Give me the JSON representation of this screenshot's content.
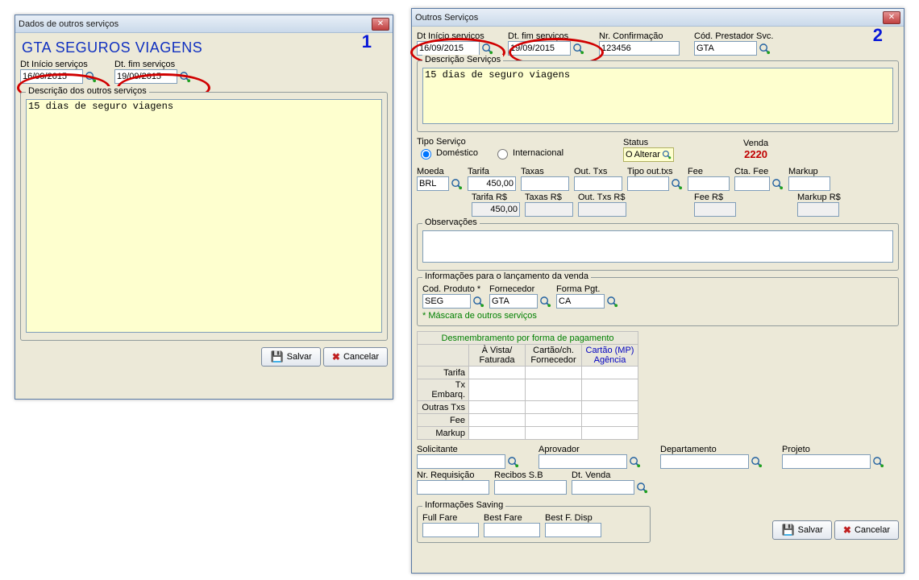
{
  "win1": {
    "title": "Dados de outros serviços",
    "big_title": "GTA SEGUROS VIAGENS",
    "annot": "1",
    "dt_inicio_lbl": "Dt Início serviços",
    "dt_inicio": "16/09/2015",
    "dt_fim_lbl": "Dt. fim serviços",
    "dt_fim": "19/09/2015",
    "desc_lbl": "Descrição dos outros serviços",
    "desc": "15 dias de seguro viagens",
    "save": "Salvar",
    "cancel": "Cancelar"
  },
  "win2": {
    "title": "Outros Serviços",
    "annot": "2",
    "dt_inicio_lbl": "Dt Início serviços",
    "dt_inicio": "16/09/2015",
    "dt_fim_lbl": "Dt. fim serviços",
    "dt_fim": "19/09/2015",
    "confirm_lbl": "Nr. Confirmação",
    "confirm": "123456",
    "prest_lbl": "Cód. Prestador Svc.",
    "prest": "GTA",
    "desc_lbl": "Descrição Serviços",
    "desc": "15 dias de seguro viagens",
    "tipo_lbl": "Tipo Serviço",
    "tipo_dom": "Doméstico",
    "tipo_int": "Internacional",
    "status_lbl": "Status",
    "status_btn": "Alterar",
    "status_prefix": "O",
    "venda_lbl": "Venda",
    "venda_num": "2220",
    "moeda_lbl": "Moeda",
    "moeda": "BRL",
    "tarifa_lbl": "Tarifa",
    "tarifa": "450,00",
    "taxas_lbl": "Taxas",
    "outtxs_lbl": "Out. Txs",
    "tipoout_lbl": "Tipo out.txs",
    "fee_lbl": "Fee",
    "ctafee_lbl": "Cta. Fee",
    "markup_lbl": "Markup",
    "tarifars_lbl": "Tarifa R$",
    "tarifars": "450,00",
    "taxasrs_lbl": "Taxas R$",
    "outtxsrs_lbl": "Out. Txs R$",
    "feers_lbl": "Fee R$",
    "markuprs_lbl": "Markup R$",
    "obs_lbl": "Observações",
    "info_lbl": "Informações para o lançamento da venda",
    "codprod_lbl": "Cod. Produto *",
    "codprod": "SEG",
    "fornec_lbl": "Fornecedor",
    "fornec": "GTA",
    "formapgt_lbl": "Forma Pgt.",
    "formapgt": "CA",
    "mask_note": "* Máscara de outros serviços",
    "grid_title": "Desmembramento por forma de pagamento",
    "cols": [
      "À Vista/ Faturada",
      "Cartão/ch. Fornecedor",
      "Cartão (MP) Agência"
    ],
    "rows": [
      "Tarifa",
      "Tx Embarq.",
      "Outras Txs",
      "Fee",
      "Markup"
    ],
    "solic_lbl": "Solicitante",
    "aprov_lbl": "Aprovador",
    "depto_lbl": "Departamento",
    "projeto_lbl": "Projeto",
    "nrreq_lbl": "Nr. Requisição",
    "recibos_lbl": "Recibos S.B",
    "dtvenda_lbl": "Dt. Venda",
    "saving_lbl": "Informações Saving",
    "fullfare_lbl": "Full Fare",
    "bestfare_lbl": "Best Fare",
    "bestdisp_lbl": "Best F. Disp",
    "save": "Salvar",
    "cancel": "Cancelar"
  }
}
